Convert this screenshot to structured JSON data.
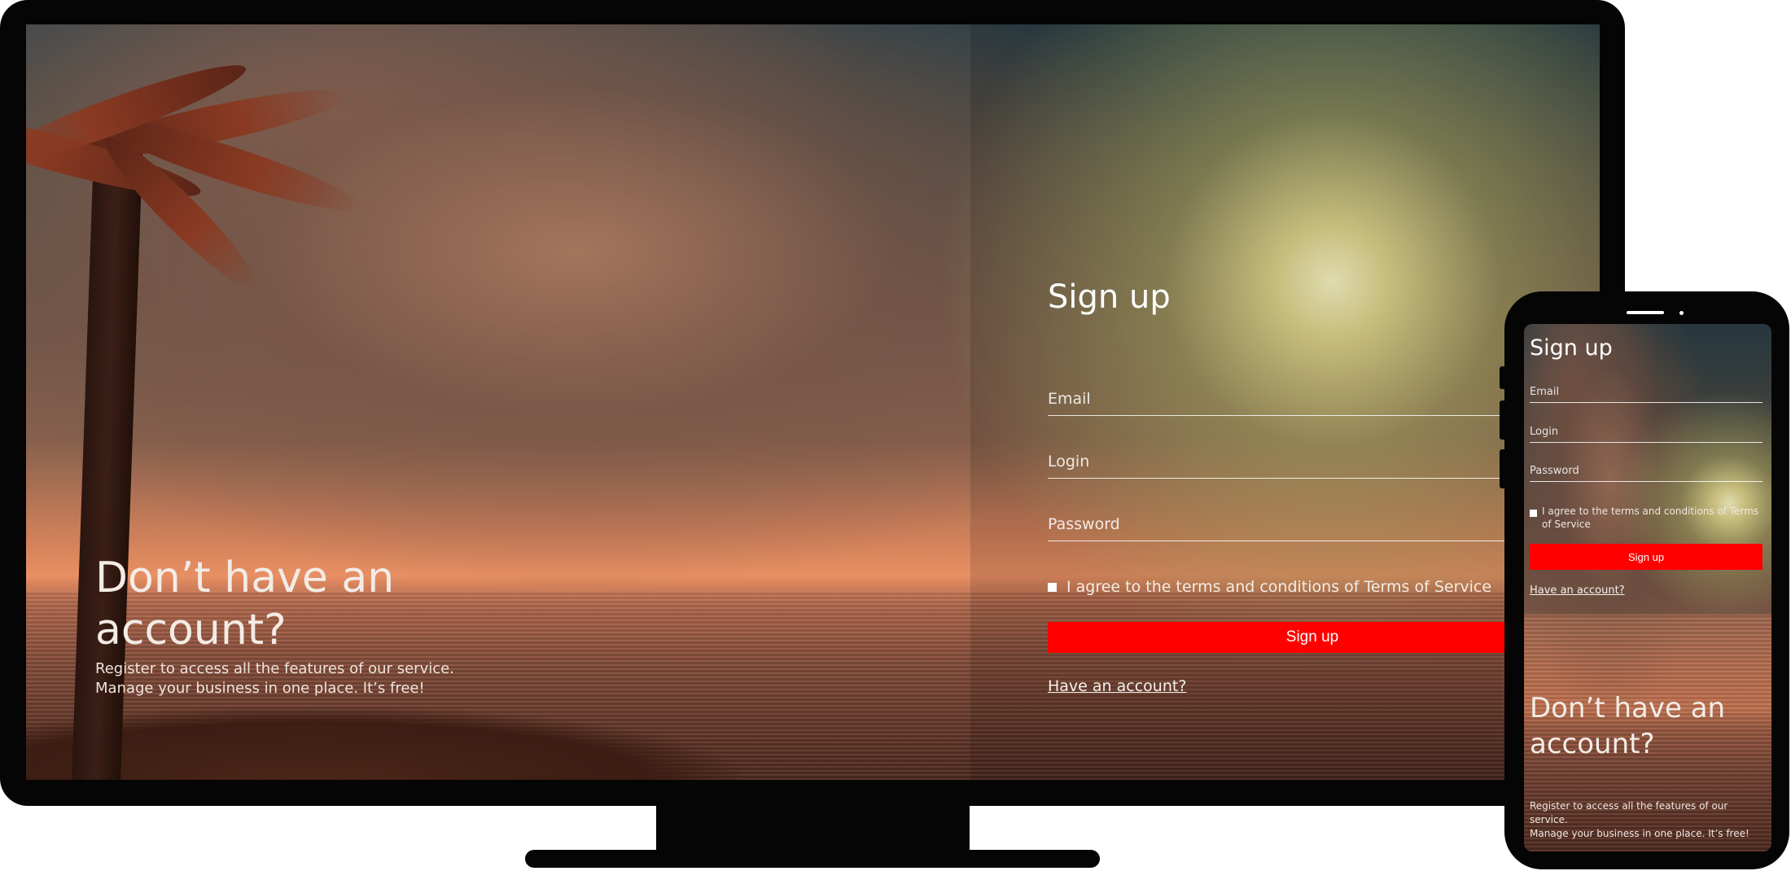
{
  "desktop": {
    "promo": {
      "headline": "Don’t have an account?",
      "sub_line1": "Register to access all the features of our service.",
      "sub_line2": "Manage your business in one place. It’s free!"
    },
    "form": {
      "title": "Sign up",
      "email_placeholder": "Email",
      "login_placeholder": "Login",
      "password_placeholder": "Password",
      "agree_label": "I agree to the terms and conditions of Terms of Service",
      "submit_label": "Sign up",
      "have_account_link": "Have an account?"
    }
  },
  "mobile": {
    "form": {
      "title": "Sign up",
      "email_placeholder": "Email",
      "login_placeholder": "Login",
      "password_placeholder": "Password",
      "agree_label": "I agree to the terms and conditions of Terms of Service",
      "submit_label": "Sign up",
      "have_account_link": "Have an account?"
    },
    "promo": {
      "headline": "Don’t have an account?",
      "sub_line1": "Register to access all the features of our service.",
      "sub_line2": "Manage your business in one place. It’s free!"
    }
  },
  "colors": {
    "accent_button": "#ff0000",
    "device_frame": "#050505",
    "text": "#ffffff"
  }
}
